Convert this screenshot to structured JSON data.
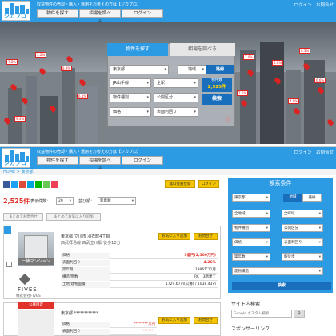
{
  "header": {
    "tagline": "収益物件の売却・購入・運用をお考えの方は【ジカプロ】",
    "nav": [
      "物件を探す",
      "相場を調べる",
      "ログイン"
    ],
    "links": "ログイン | お問合せ",
    "logo_text": "ジカプロ"
  },
  "hero": {
    "tabs": {
      "search": "物件を探す",
      "market": "相場を調べる"
    },
    "fields": {
      "pref": "東京都",
      "area": "地域",
      "route": "路線"
    },
    "line": "JR山手線",
    "station": "全駅",
    "type": "物件種別",
    "tax": "公開区分",
    "price": "価格",
    "yield": "表面利回り",
    "count_label": "物件数",
    "count_value": "2,525件",
    "search_btn": "検索",
    "pin_labels": [
      "7.8%",
      "5.2%",
      "8.9%",
      "6.1%",
      "9.4%",
      "7.0%",
      "5.8%",
      "8.3%",
      "6.6%",
      "7.5%",
      "4.9%"
    ]
  },
  "breadcrumb": "HOME > 東京都",
  "results": {
    "count": "2,525件",
    "per_page_label": "表示件数：",
    "per_page_value": "20",
    "sort_label": "並び順：",
    "sort_value": "新着順",
    "register_btn": "無料会員登録",
    "login_btn": "ログイン",
    "bulk_inquiry_btn": "まとめてお問合せ",
    "bulk_fav_btn": "まとめてお気に入り追加"
  },
  "listing": {
    "address": "東京都 立川市 羽衣町4丁目",
    "access": "西武拝島線 西武立川駅 徒歩10分",
    "fav_btn": "お気に入り追加",
    "inquiry_btn": "お問合せ",
    "type_badge": "一棟マンション",
    "company": "FIVES",
    "company_name": "株式会社FIVES",
    "rows": [
      {
        "k": "価格",
        "v": "3億円(2,500万円)"
      },
      {
        "k": "表面利回り",
        "v": "4.26%"
      },
      {
        "k": "築年月",
        "v": "1996年11月"
      },
      {
        "k": "構造/階数",
        "v": "RC　3階建て"
      },
      {
        "k": "土地/建物面積",
        "v": "1729.67㎡(公簿) / 1038.43㎡"
      }
    ]
  },
  "listing2": {
    "badge": "公募限定",
    "address": "東京都 ************",
    "fav_btn": "お気に入り追加",
    "inquiry_btn": "お問合せ",
    "rows": [
      {
        "k": "価格",
        "v": "********万円"
      },
      {
        "k": "表面利回り",
        "v": "********"
      }
    ]
  },
  "sidebar": {
    "title": "検索条件",
    "pref": "東京都",
    "area_tab": "地域",
    "route_tab": "路線",
    "city": "全地域",
    "town": "全町域",
    "type": "物件種別",
    "tax": "公開区分",
    "price": "価格",
    "yield": "表面利回り",
    "age": "築年数",
    "walk": "駅徒歩",
    "structure": "建物構造",
    "search_btn": "検索",
    "site_search_title": "サイト内検索",
    "site_search_placeholder": "Google カスタム検索",
    "sponsor_title": "スポンサーリンク"
  },
  "colors": {
    "accent": "#2d9be3",
    "price": "#e0312a",
    "button": "#1a6fbd",
    "badge": "#f5c400"
  }
}
